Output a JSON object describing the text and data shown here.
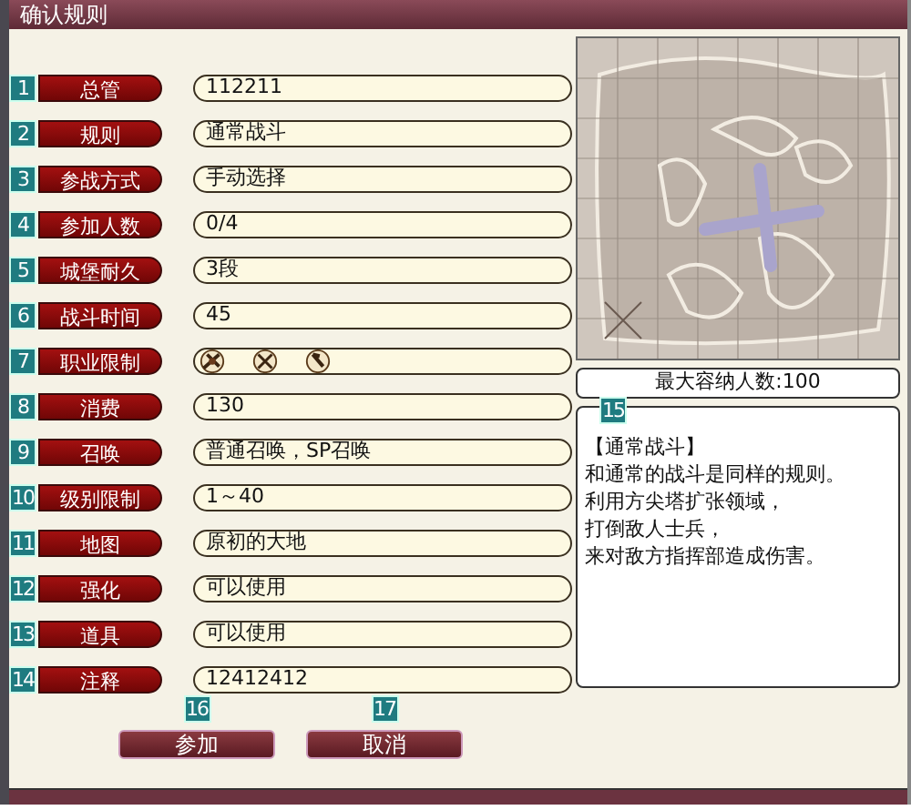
{
  "window": {
    "title": "确认规则"
  },
  "rules": [
    {
      "number": "1",
      "label": "总管",
      "kind": "text",
      "value": "112211"
    },
    {
      "number": "2",
      "label": "规则",
      "kind": "text",
      "value": "通常战斗"
    },
    {
      "number": "3",
      "label": "参战方式",
      "kind": "text",
      "value": "手动选择"
    },
    {
      "number": "4",
      "label": "参加人数",
      "kind": "text",
      "value": "0/4"
    },
    {
      "number": "5",
      "label": "城堡耐久",
      "kind": "text",
      "value": "3段"
    },
    {
      "number": "6",
      "label": "战斗时间",
      "kind": "text",
      "value": "45"
    },
    {
      "number": "7",
      "label": "职业限制",
      "kind": "icons"
    },
    {
      "number": "8",
      "label": "消费",
      "kind": "text",
      "value": "130"
    },
    {
      "number": "9",
      "label": "召唤",
      "kind": "text",
      "value": "普通召唤，SP召唤"
    },
    {
      "number": "10",
      "label": "级别限制",
      "kind": "text",
      "value": "1～40"
    },
    {
      "number": "11",
      "label": "地图",
      "kind": "text",
      "value": "原初的大地"
    },
    {
      "number": "12",
      "label": "强化",
      "kind": "text",
      "value": "可以使用"
    },
    {
      "number": "13",
      "label": "道具",
      "kind": "text",
      "value": "可以使用"
    },
    {
      "number": "14",
      "label": "注释",
      "kind": "text",
      "value": "12412412"
    }
  ],
  "buttons": [
    {
      "number": "16",
      "label": "参加"
    },
    {
      "number": "17",
      "label": "取消"
    }
  ],
  "map": {
    "kind": "picture",
    "capacity": "最大容纳人数:100"
  },
  "description": {
    "number": "15",
    "lines": [
      "【通常战斗】",
      "和通常的战斗是同样的规则。",
      "利用方尖塔扩张领域，",
      "打倒敌人士兵，",
      "来对敌方指挥部造成伤害。"
    ]
  }
}
